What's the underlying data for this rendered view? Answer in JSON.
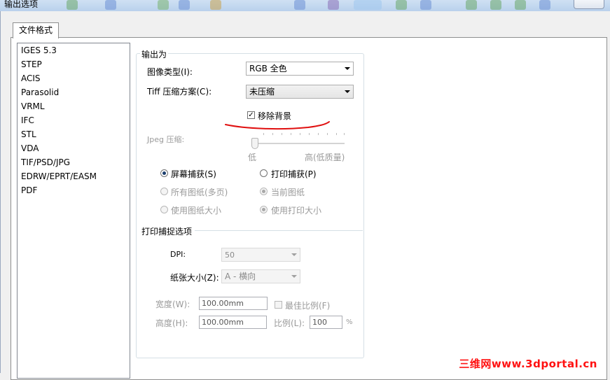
{
  "window": {
    "title": "输出选项"
  },
  "tab": {
    "label": "文件格式"
  },
  "formats": [
    "IGES 5.3",
    "STEP",
    "ACIS",
    "Parasolid",
    "VRML",
    "IFC",
    "STL",
    "VDA",
    "TIF/PSD/JPG",
    "EDRW/EPRT/EASM",
    "PDF"
  ],
  "selected_format": "TIF/PSD/JPG",
  "output": {
    "group_title": "输出为",
    "image_type_label": "图像类型(I):",
    "image_type_value": "RGB 全色",
    "tiff_label": "Tiff 压缩方案(C):",
    "tiff_value": "未压缩",
    "remove_bg_label": "移除背景",
    "remove_bg_checked": true,
    "jpeg_label": "Jpeg 压缩:",
    "jpeg_low": "低",
    "jpeg_high": "高(低质量)",
    "screen_capture": "屏幕捕获(S)",
    "print_capture": "打印捕获(P)",
    "capture_mode": "screen",
    "all_sheets": "所有图纸(多页)",
    "current_sheet": "当前图纸",
    "use_sheet_size": "使用图纸大小",
    "use_print_size": "使用打印大小"
  },
  "print_options": {
    "section_title": "打印捕捉选项",
    "dpi_label": "DPI:",
    "dpi_value": "50",
    "paper_label": "纸张大小(Z):",
    "paper_value": "A - 横向",
    "width_label": "宽度(W):",
    "width_value": "100.00mm",
    "height_label": "高度(H):",
    "height_value": "100.00mm",
    "best_fit_label": "最佳比例(F)",
    "scale_label": "比例(L):",
    "scale_value": "100",
    "scale_unit": "%"
  },
  "watermark": "三维网www.3dportal.cn",
  "colors": {
    "annotation": "#e01010",
    "watermark": "#ff1111",
    "title_bar": "#c3d8ef"
  }
}
